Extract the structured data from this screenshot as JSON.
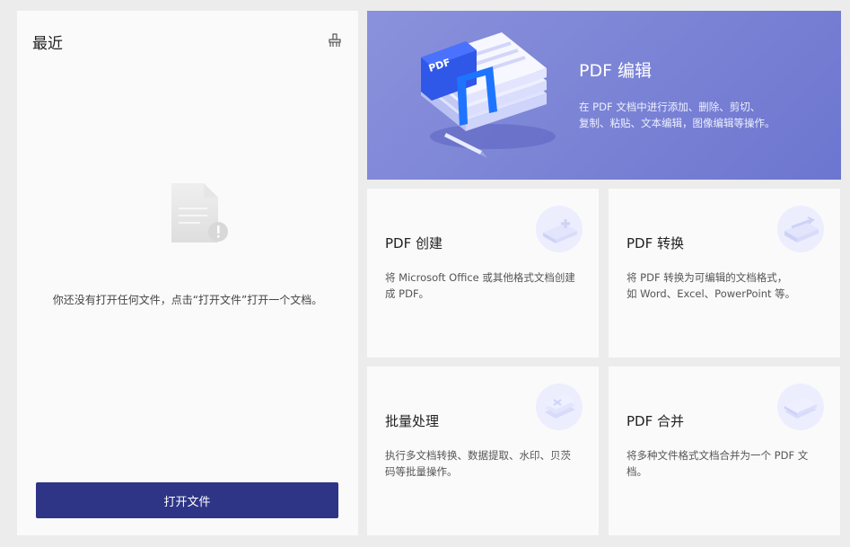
{
  "recent": {
    "title": "最近",
    "empty_text": "你还没有打开任何文件，点击“打开文件”打开一个文档。",
    "open_button": "打开文件"
  },
  "hero": {
    "title": "PDF 编辑",
    "desc_line1": "在 PDF 文档中进行添加、删除、剪切、",
    "desc_line2": "复制、粘贴、文本编辑，图像编辑等操作。",
    "illustration_label": "PDF"
  },
  "cards": [
    {
      "title": "PDF 创建",
      "desc_line1": "将 Microsoft Office 或其他格式文档创建",
      "desc_line2": "成 PDF。"
    },
    {
      "title": "PDF 转换",
      "desc_line1": "将 PDF 转换为可编辑的文档格式，",
      "desc_line2": "如 Word、Excel、PowerPoint 等。"
    },
    {
      "title": "批量处理",
      "desc_line1": "执行多文档转换、数据提取、水印、贝茨",
      "desc_line2": "码等批量操作。"
    },
    {
      "title": "PDF 合并",
      "desc_line1": "将多种文件格式文档合并为一个 PDF 文",
      "desc_line2": "档。"
    }
  ],
  "colors": {
    "accent_button": "#2e3586",
    "hero_bg": "#7b83d6",
    "page_bg": "#ececec",
    "card_bg": "#fafafa"
  },
  "icons": {
    "clean": "broom-icon",
    "empty": "empty-document-icon",
    "hero": "pdf-edit-illustration",
    "create": "pdf-create-icon",
    "convert": "pdf-convert-icon",
    "batch": "batch-process-icon",
    "merge": "pdf-merge-icon"
  }
}
